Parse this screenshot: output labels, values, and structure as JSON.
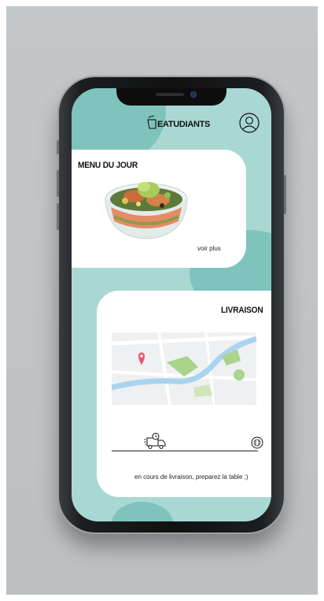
{
  "app": {
    "logo_text": "EATUDIANTS"
  },
  "menu_card": {
    "title": "MENU DU JOUR",
    "link_label": "voir plus"
  },
  "delivery_card": {
    "title": "LIVRAISON",
    "status_text": "en cours de livraison, preparez la table ;)"
  },
  "colors": {
    "screen_bg": "#a9d8d4",
    "accent_blob": "#7fc3bd",
    "card_bg": "#ffffff",
    "map_pin": "#e8556e",
    "map_water": "#a9d4ee",
    "map_green": "#a8d48c"
  },
  "icons": [
    "logo-icon",
    "profile-icon",
    "bowl-image",
    "map-pin-icon",
    "delivery-truck-icon",
    "dish-icon"
  ]
}
